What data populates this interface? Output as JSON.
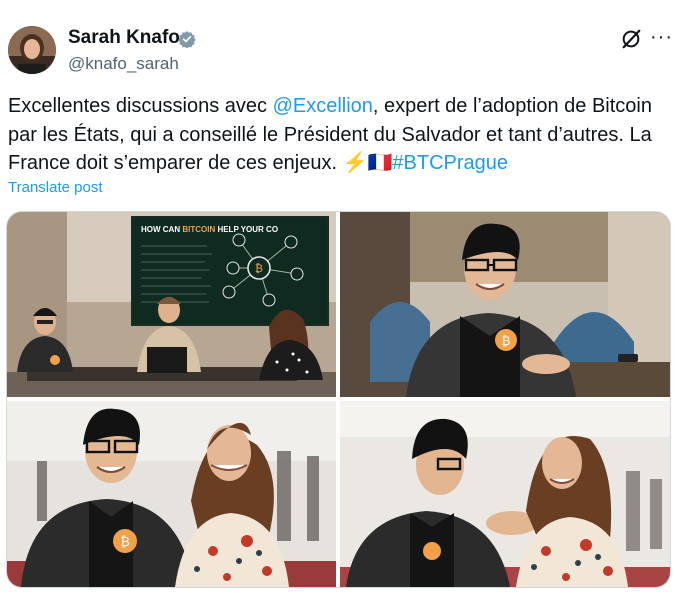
{
  "author": {
    "name": "Sarah Knafo",
    "handle": "@knafo_sarah"
  },
  "post": {
    "text_1": "Excellentes discussions avec ",
    "mention": "@Excellion",
    "text_2": ", expert de l’adoption de Bitcoin par les États, qui a conseillé le Président du Salvador et tant d’autres. La France doit s’emparer de ces enjeux. ",
    "emoji": "⚡🇫🇷",
    "hashtag": "#BTCPrague",
    "translate_label": "Translate post"
  },
  "slide": {
    "title_1": "HOW CAN ",
    "title_2": "BITCOIN",
    "title_3": " HELP YOUR CO",
    "icon_center": "₿"
  },
  "colors": {
    "link": "#1d9bf0",
    "text": "#0f1419",
    "secondary": "#536471",
    "bitcoin": "#f2a04a"
  },
  "icons": [
    "verified-badge-icon",
    "grok-icon",
    "more-icon",
    "bitcoin-badge-icon"
  ]
}
